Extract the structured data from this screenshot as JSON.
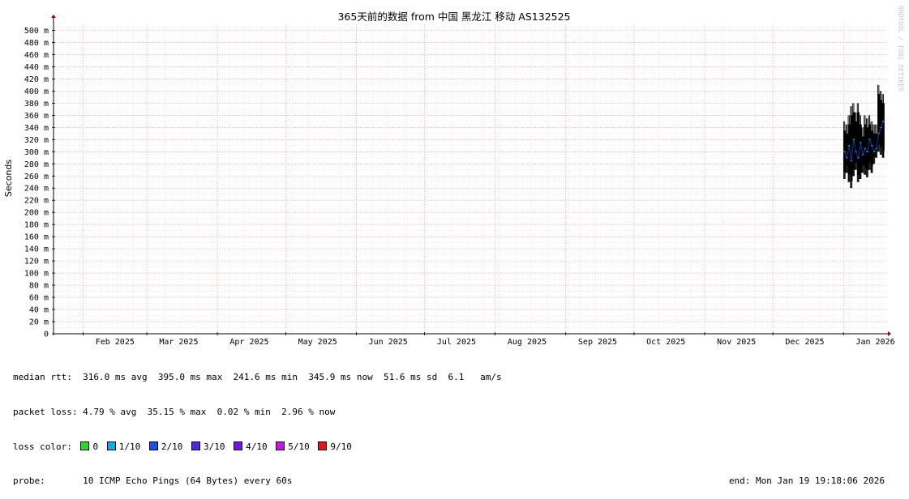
{
  "chart_data": {
    "type": "line",
    "title": "365天前的数据 from  中国 黑龙江 移动 AS132525",
    "ylabel": "Seconds",
    "watermark": "RRDTOOL / TOBI OETIKER",
    "ylim": [
      0,
      0.51
    ],
    "y_ticks": [
      {
        "v": 0,
        "label": "0"
      },
      {
        "v": 0.02,
        "label": "20 m"
      },
      {
        "v": 0.04,
        "label": "40 m"
      },
      {
        "v": 0.06,
        "label": "60 m"
      },
      {
        "v": 0.08,
        "label": "80 m"
      },
      {
        "v": 0.1,
        "label": "100 m"
      },
      {
        "v": 0.12,
        "label": "120 m"
      },
      {
        "v": 0.14,
        "label": "140 m"
      },
      {
        "v": 0.16,
        "label": "160 m"
      },
      {
        "v": 0.18,
        "label": "180 m"
      },
      {
        "v": 0.2,
        "label": "200 m"
      },
      {
        "v": 0.22,
        "label": "220 m"
      },
      {
        "v": 0.24,
        "label": "240 m"
      },
      {
        "v": 0.26,
        "label": "260 m"
      },
      {
        "v": 0.28,
        "label": "280 m"
      },
      {
        "v": 0.3,
        "label": "300 m"
      },
      {
        "v": 0.32,
        "label": "320 m"
      },
      {
        "v": 0.34,
        "label": "340 m"
      },
      {
        "v": 0.36,
        "label": "360 m"
      },
      {
        "v": 0.38,
        "label": "380 m"
      },
      {
        "v": 0.4,
        "label": "400 m"
      },
      {
        "v": 0.42,
        "label": "420 m"
      },
      {
        "v": 0.44,
        "label": "440 m"
      },
      {
        "v": 0.46,
        "label": "460 m"
      },
      {
        "v": 0.48,
        "label": "480 m"
      },
      {
        "v": 0.5,
        "label": "500 m"
      }
    ],
    "xlim": [
      "2025-01-19",
      "2026-01-19"
    ],
    "x_month_labels": [
      {
        "label": "Feb 2025",
        "center": "2025-02-15"
      },
      {
        "label": "Mar 2025",
        "center": "2025-03-15"
      },
      {
        "label": "Apr 2025",
        "center": "2025-04-15"
      },
      {
        "label": "May 2025",
        "center": "2025-05-15"
      },
      {
        "label": "Jun 2025",
        "center": "2025-06-15"
      },
      {
        "label": "Jul 2025",
        "center": "2025-07-15"
      },
      {
        "label": "Aug 2025",
        "center": "2025-08-15"
      },
      {
        "label": "Sep 2025",
        "center": "2025-09-15"
      },
      {
        "label": "Oct 2025",
        "center": "2025-10-15"
      },
      {
        "label": "Nov 2025",
        "center": "2025-11-15"
      },
      {
        "label": "Dec 2025",
        "center": "2025-12-15"
      },
      {
        "label": "Jan 2026",
        "center": "2026-01-15"
      }
    ],
    "x_major_grid": [
      "2025-02-01",
      "2025-03-01",
      "2025-04-01",
      "2025-05-01",
      "2025-06-01",
      "2025-07-01",
      "2025-08-01",
      "2025-09-01",
      "2025-10-01",
      "2025-11-01",
      "2025-12-01",
      "2026-01-01"
    ],
    "grid": true,
    "series": [
      {
        "color": "#000000",
        "points": [
          [
            "2026-01-01",
            0.255,
            0.35,
            0.3
          ],
          [
            "2026-01-02",
            0.265,
            0.345,
            0.29
          ],
          [
            "2026-01-03",
            0.25,
            0.36,
            0.31
          ],
          [
            "2026-01-04",
            0.24,
            0.375,
            0.285
          ],
          [
            "2026-01-05",
            0.26,
            0.38,
            0.32
          ],
          [
            "2026-01-06",
            0.27,
            0.365,
            0.3
          ],
          [
            "2026-01-07",
            0.25,
            0.38,
            0.29
          ],
          [
            "2026-01-08",
            0.255,
            0.36,
            0.315
          ],
          [
            "2026-01-09",
            0.265,
            0.34,
            0.295
          ],
          [
            "2026-01-10",
            0.262,
            0.36,
            0.305
          ],
          [
            "2026-01-11",
            0.258,
            0.355,
            0.3
          ],
          [
            "2026-01-12",
            0.27,
            0.36,
            0.32
          ],
          [
            "2026-01-13",
            0.265,
            0.35,
            0.31
          ],
          [
            "2026-01-14",
            0.28,
            0.345,
            0.3
          ],
          [
            "2026-01-15",
            0.29,
            0.345,
            0.305
          ],
          [
            "2026-01-16",
            0.3,
            0.41,
            0.33
          ],
          [
            "2026-01-17",
            0.295,
            0.4,
            0.34
          ],
          [
            "2026-01-18",
            0.29,
            0.395,
            0.35
          ]
        ]
      }
    ],
    "legend_colors": {
      "0": "#22dd22",
      "1/10": "#11aaee",
      "2/10": "#1155ee",
      "3/10": "#5522ee",
      "4/10": "#7711ee",
      "5/10": "#cc11ee",
      "9/10": "#ee1111"
    }
  },
  "stats": {
    "rtt_label": "median rtt:",
    "rtt_values": "316.0 ms avg  395.0 ms max  241.6 ms min  345.9 ms now  51.6 ms sd  6.1   am/s",
    "loss_label": "packet loss:",
    "loss_values": "4.79 % avg  35.15 % max  0.02 % min  2.96 % now",
    "color_label": "loss color:",
    "colors": [
      {
        "label": "0",
        "color": "#22dd22"
      },
      {
        "label": "1/10",
        "color": "#11aaee"
      },
      {
        "label": "2/10",
        "color": "#1155ee"
      },
      {
        "label": "3/10",
        "color": "#5522ee"
      },
      {
        "label": "4/10",
        "color": "#7711ee"
      },
      {
        "label": "5/10",
        "color": "#cc11ee"
      },
      {
        "label": "9/10",
        "color": "#ee1111"
      }
    ],
    "probe_label": "probe:",
    "probe_value": "10 ICMP Echo Pings (64 Bytes) every 60s",
    "end_text": "end: Mon Jan 19 19:18:06 2026"
  }
}
